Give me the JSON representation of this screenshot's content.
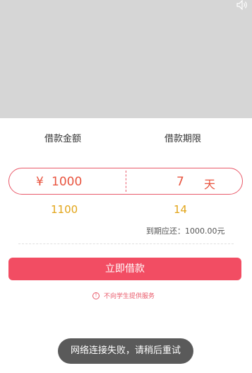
{
  "banner": {
    "speaker_icon": "speaker-icon"
  },
  "form": {
    "amount_label": "借款金额",
    "period_label": "借款期限",
    "currency_symbol": "¥",
    "amount_value": "1000",
    "days_value": "7",
    "days_unit": "天",
    "amount_option": "1100",
    "days_option": "14",
    "due_text": "到期应还：1000.00元"
  },
  "actions": {
    "borrow_button": "立即借款"
  },
  "notice": {
    "icon": "info-icon",
    "text": "不向学生提供服务"
  },
  "toast": {
    "text": "网络连接失败，请稍后重试"
  },
  "colors": {
    "accent": "#f24d63",
    "input_text": "#e8543f",
    "option_text": "#e2a417"
  }
}
